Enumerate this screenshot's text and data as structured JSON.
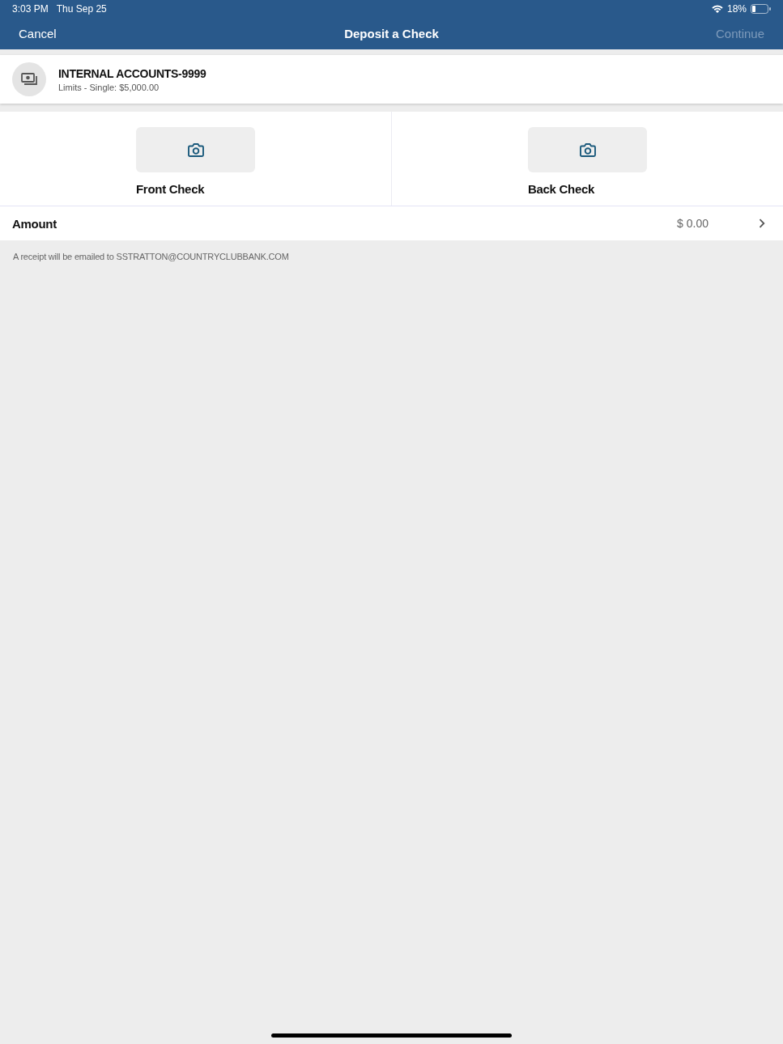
{
  "status_bar": {
    "time": "3:03 PM",
    "date": "Thu Sep 25",
    "battery": "18%"
  },
  "nav_bar": {
    "cancel": "Cancel",
    "title": "Deposit a Check",
    "continue": {
      "label": "Continue",
      "disabled": true
    }
  },
  "account": {
    "name": "INTERNAL ACCOUNTS-9999",
    "limits": "Limits - Single: $5,000.00"
  },
  "captures": [
    {
      "label": "Front Check"
    },
    {
      "label": "Back Check"
    }
  ],
  "amount": {
    "label": "Amount",
    "value": "$ 0.00"
  },
  "receipt_note": "A receipt will be emailed to SSTRATTON@COUNTRYCLUBBANK.COM"
}
